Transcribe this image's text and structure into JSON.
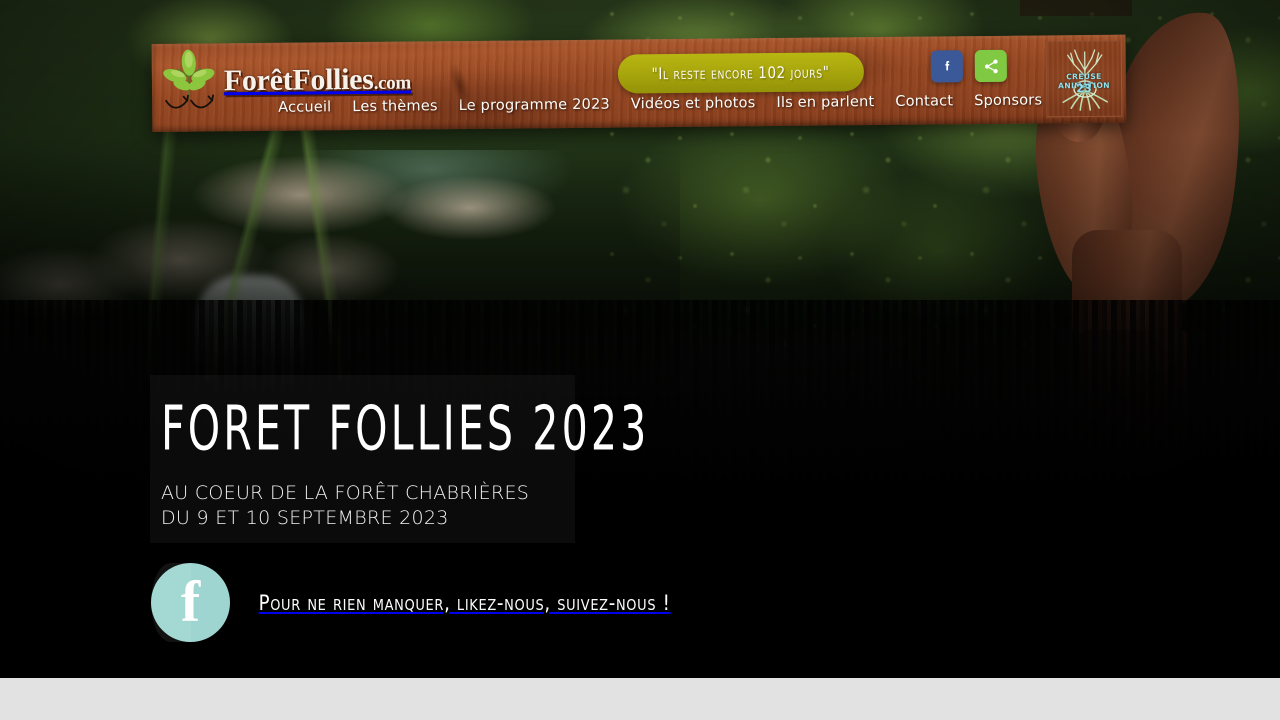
{
  "site": {
    "brand_name": "ForêtFollies",
    "brand_tld": ".com",
    "logo_icon": "pine-sprig-icon"
  },
  "header": {
    "nav": [
      {
        "label": "Accueil"
      },
      {
        "label": "Les thèmes"
      },
      {
        "label": "Le programme 2023"
      },
      {
        "label": "Vidéos et photos"
      },
      {
        "label": "Ils en parlent"
      },
      {
        "label": "Contact"
      },
      {
        "label": "Sponsors"
      }
    ],
    "countdown_label": "\"Il reste encore 102 jours\"",
    "countdown_days": 102,
    "social": [
      {
        "name": "facebook-icon",
        "glyph": "f",
        "color": "#3B5998"
      },
      {
        "name": "share-icon",
        "glyph": "",
        "color": "#7FC943"
      }
    ],
    "partner_logo": {
      "label": "CREUSE ANIMATION",
      "number": "23",
      "icon": "tree-with-roots-icon"
    }
  },
  "hero": {
    "title": "FORET FOLLIES 2023",
    "subtitle_line1": "AU COEUR DE LA FORÊT CHABRIÈRES",
    "subtitle_line2": "DU 9 ET 10 SEPTEMBRE 2023"
  },
  "cta": {
    "facebook_glyph": "f",
    "facebook_icon": "facebook-round-icon",
    "text": "Pour ne rien manquer, likez-nous, suivez-nous !"
  },
  "colors": {
    "wood": "#93441F",
    "countdown_olive": "#A6A40C",
    "facebook_blue": "#3B5998",
    "share_green": "#7FC943",
    "cta_teal": "#9ED5D0",
    "page_background": "#E2E2E2"
  }
}
